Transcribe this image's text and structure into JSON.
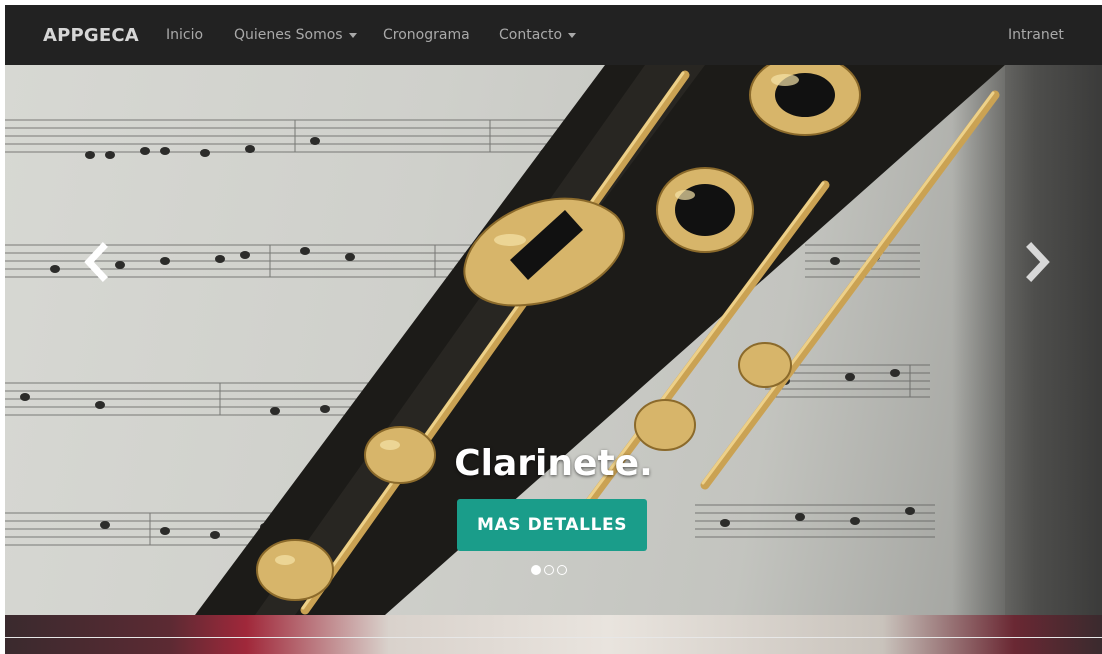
{
  "navbar": {
    "brand": "APPGECA",
    "items": [
      {
        "label": "Inicio",
        "dropdown": false
      },
      {
        "label": "Quienes Somos",
        "dropdown": true
      },
      {
        "label": "Cronograma",
        "dropdown": false
      },
      {
        "label": "Contacto",
        "dropdown": true
      }
    ],
    "right_item": "Intranet"
  },
  "carousel": {
    "caption_title": "Clarinete.",
    "cta_label": "MAS DETALLES",
    "slide_count": 3,
    "active_slide": 1,
    "prev_icon": "chevron-left-icon",
    "next_icon": "chevron-right-icon"
  },
  "colors": {
    "navbar_bg": "#222222",
    "cta_bg": "#1a9d8a",
    "nav_text": "#a9a9a9",
    "brand_text": "#d6d6d6"
  }
}
